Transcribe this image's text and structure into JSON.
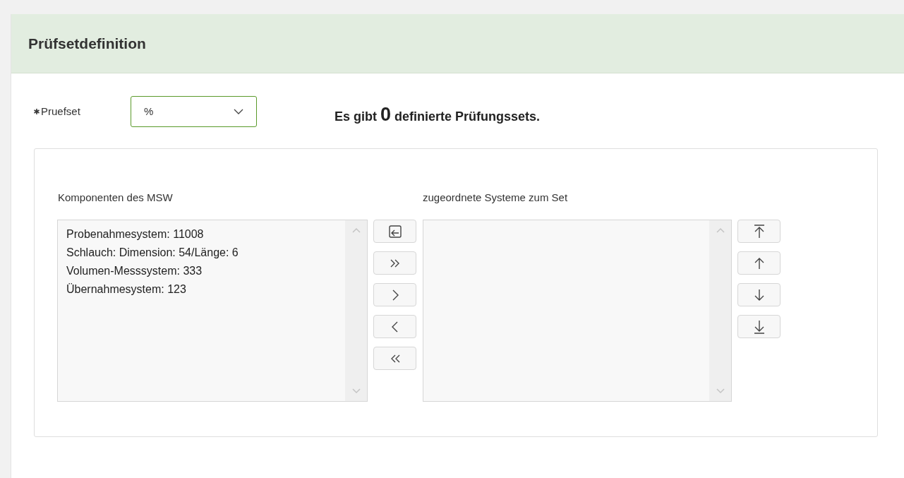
{
  "panel": {
    "title": "Prüfsetdefinition"
  },
  "pruefset": {
    "label": "Pruefset",
    "required": true,
    "value": "%"
  },
  "summary": {
    "before": "Es gibt",
    "count": "0",
    "after": "definierte Prüfungssets."
  },
  "source_list": {
    "label": "Komponenten des MSW",
    "items": [
      {
        "text": "Probenahmesystem: 11008",
        "selected": false
      },
      {
        "text": "Schlauch: Dimension: 54/Länge: 6",
        "selected": false
      },
      {
        "text": "Volumen-Messsystem: 333",
        "selected": false
      },
      {
        "text": "Übernahmesystem: 123",
        "selected": false
      }
    ]
  },
  "transfer_buttons": [
    {
      "kind": "reset"
    },
    {
      "kind": "all-right"
    },
    {
      "kind": "right"
    },
    {
      "kind": "left"
    },
    {
      "kind": "all-left"
    }
  ],
  "target_list": {
    "label": "zugeordnete Systeme zum Set"
  },
  "order_buttons": [
    {
      "kind": "top"
    },
    {
      "kind": "up"
    },
    {
      "kind": "down"
    },
    {
      "kind": "bottom"
    }
  ]
}
